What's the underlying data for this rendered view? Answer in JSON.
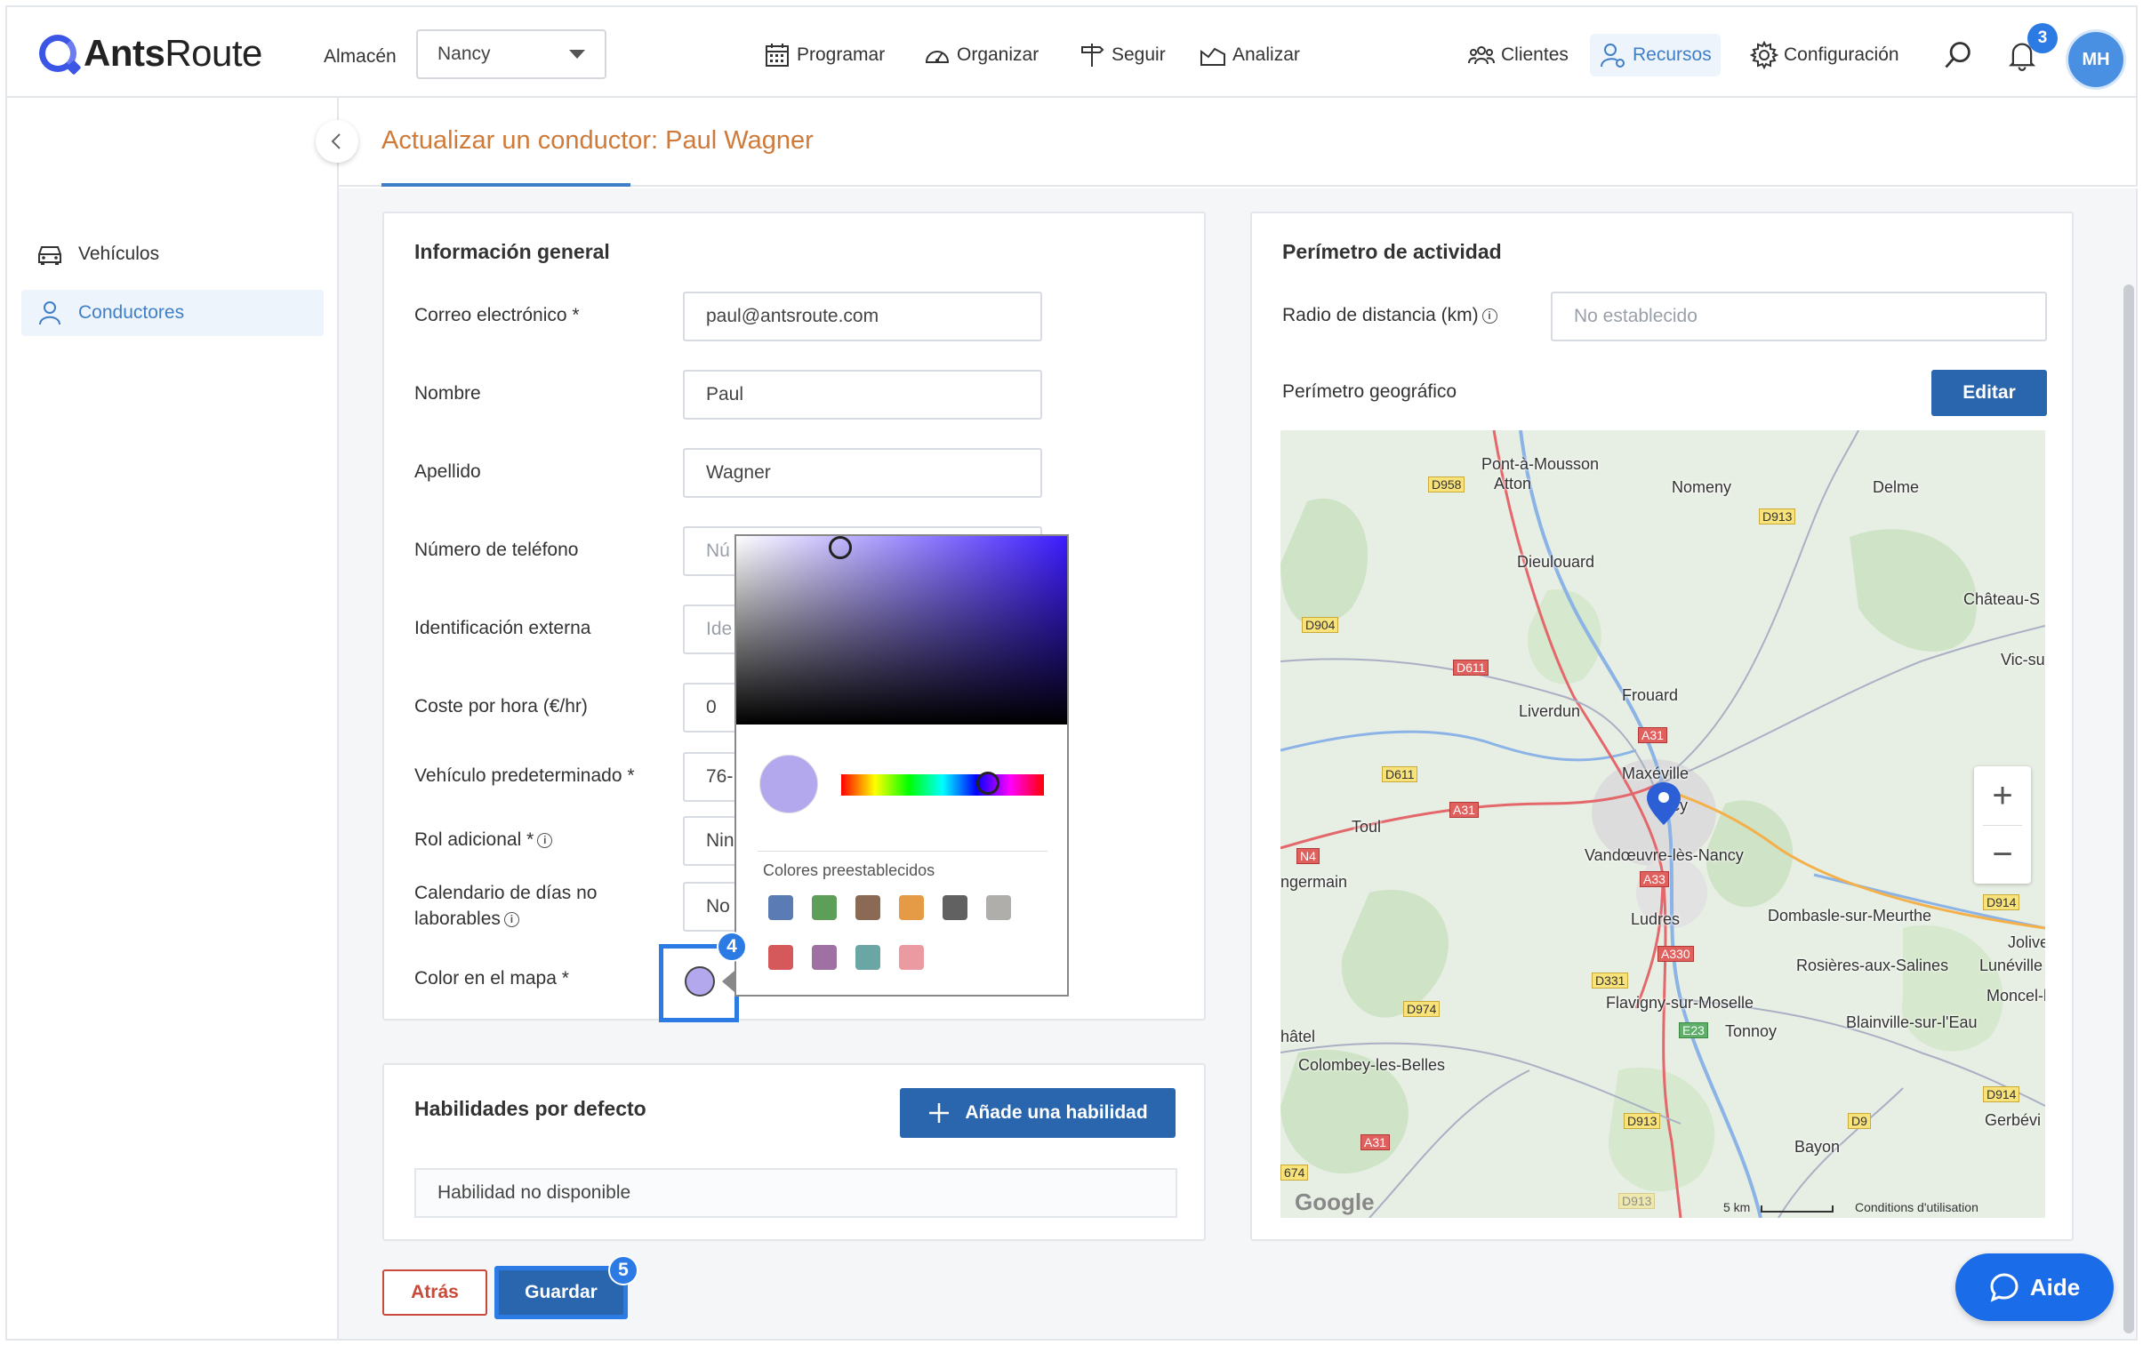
{
  "header": {
    "logo_bold": "Ants",
    "logo_light": "Route",
    "almacen_label": "Almacén",
    "almacen_value": "Nancy",
    "nav": [
      {
        "label": "Programar"
      },
      {
        "label": "Organizar"
      },
      {
        "label": "Seguir"
      },
      {
        "label": "Analizar"
      }
    ],
    "right_nav": [
      {
        "label": "Clientes"
      },
      {
        "label": "Recursos"
      },
      {
        "label": "Configuración"
      }
    ],
    "notifications_count": "3",
    "avatar_initials": "MH"
  },
  "sidebar": {
    "items": [
      {
        "label": "Vehículos"
      },
      {
        "label": "Conductores"
      }
    ]
  },
  "page": {
    "title": "Actualizar un conductor: Paul Wagner"
  },
  "general": {
    "title": "Información general",
    "fields": [
      {
        "label": "Correo electrónico *",
        "value": "paul@antsroute.com"
      },
      {
        "label": "Nombre",
        "value": "Paul"
      },
      {
        "label": "Apellido",
        "value": "Wagner"
      },
      {
        "label": "Número de teléfono",
        "value": "Nú"
      },
      {
        "label": "Identificación externa",
        "value": "Ide"
      },
      {
        "label": "Coste por hora (€/hr)",
        "value": "0"
      },
      {
        "label": "Vehículo predeterminado *",
        "value": "76-"
      },
      {
        "label": "Rol adicional *",
        "value": "Nin"
      },
      {
        "label": "Calendario de días no laborables",
        "value": "No"
      },
      {
        "label": "Color en el mapa *",
        "value": ""
      }
    ],
    "map_color": "#b3a7ee"
  },
  "picker": {
    "presets_label": "Colores preestablecidos",
    "presets": [
      "#5b7bb4",
      "#5d9e58",
      "#8b6a55",
      "#e59a45",
      "#616161",
      "#b0aeab",
      "#d5585a",
      "#9f71a3",
      "#6aa6a4",
      "#eb9aa2"
    ]
  },
  "skills": {
    "title": "Habilidades por defecto",
    "add_button": "Añade una habilidad",
    "empty": "Habilidad no disponible"
  },
  "actions": {
    "back": "Atrás",
    "save": "Guardar"
  },
  "badges": {
    "step4": "4",
    "step5": "5"
  },
  "perimeter": {
    "title": "Perímetro de actividad",
    "radius_label": "Radio de distancia (km)",
    "radius_placeholder": "No establecido",
    "geo_label": "Perímetro geográfico",
    "edit_button": "Editar"
  },
  "map": {
    "places": [
      "Pont-à-Mousson",
      "Atton",
      "Nomeny",
      "Delme",
      "Dieulouard",
      "Château-S",
      "Vic-su",
      "Frouard",
      "Liverdun",
      "Maxéville",
      "ncy",
      "Toul",
      "Vandœuvre-lès-Nancy",
      "ngermain",
      "Ludres",
      "Dombasle-sur-Meurthe",
      "Jolive",
      "Lunéville",
      "Rosières-aux-Salines",
      "Moncel-lè",
      "Flavigny-sur-Moselle",
      "Tonnoy",
      "Blainville-sur-l'Eau",
      "hâtel",
      "Colombey-les-Belles",
      "Gerbévi",
      "Bayon"
    ],
    "roads": [
      "D958",
      "D913",
      "D904",
      "D611",
      "A31",
      "D611",
      "A31",
      "N4",
      "A33",
      "A330",
      "D914",
      "D331",
      "D974",
      "E23",
      "D914",
      "D913",
      "D9",
      "A31",
      "674",
      "D913"
    ],
    "scale": "5 km",
    "terms": "Conditions d'utilisation",
    "google": "Google"
  },
  "help": {
    "label": "Aide"
  }
}
